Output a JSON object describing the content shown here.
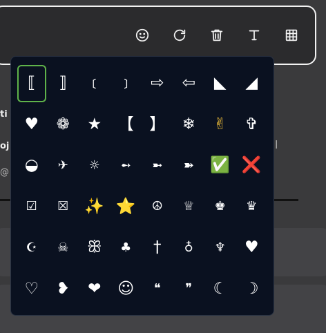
{
  "toolbar": {
    "icons": [
      "smiley-icon",
      "refresh-icon",
      "trash-icon",
      "text-icon",
      "grid-icon"
    ]
  },
  "background": {
    "strip_texts": [
      "ti",
      "oj",
      "@"
    ],
    "right_text": "l"
  },
  "picker": {
    "selected_index": 0,
    "symbols": [
      "⟦",
      "⟧",
      "﹝",
      "﹞",
      "⇨",
      "⇦",
      "◣",
      "◢",
      "♥",
      "❁",
      "★",
      "【",
      "】",
      "❄",
      "✌",
      "✞",
      "◒",
      "✈",
      "☼",
      "➻",
      "➼",
      "➽",
      "✅",
      "❌",
      "☑",
      "☒",
      "✨",
      "⭐",
      "☮",
      "♕",
      "♚",
      "♛",
      "☪",
      "☠",
      "ꕥ",
      "♣",
      "†",
      "♁",
      "♆",
      "♥",
      "♡",
      "❥",
      "❤",
      "☺",
      "❝",
      "❞",
      "☾",
      "☽"
    ]
  }
}
